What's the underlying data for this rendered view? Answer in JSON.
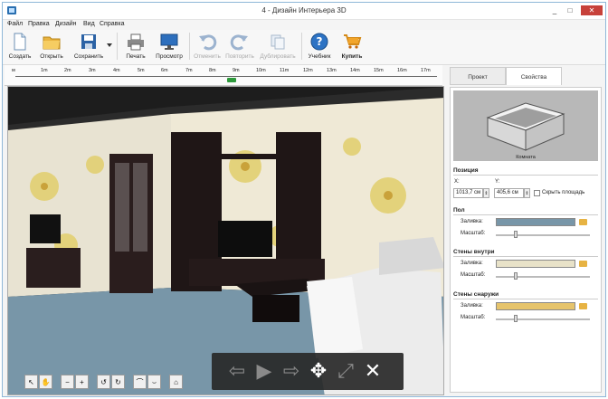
{
  "window": {
    "title": "4 - Дизайн Интерьера 3D",
    "minimize": "_",
    "maximize": "□",
    "close": "✕"
  },
  "menu": [
    "Файл",
    "Правка",
    "Дизайн",
    "Вид",
    "Справка"
  ],
  "toolbar": {
    "create": "Создать",
    "open": "Открыть",
    "save": "Сохранить",
    "print": "Печать",
    "preview": "Просмотр",
    "undo": "Отменить",
    "redo": "Повторить",
    "duplicate": "Дублировать",
    "tutorial": "Учебник",
    "buy": "Купить"
  },
  "ruler": {
    "ticks": [
      "м",
      "1m",
      "2m",
      "3m",
      "4m",
      "5m",
      "6m",
      "7m",
      "8m",
      "9m",
      "10m",
      "11m",
      "12m",
      "13m",
      "14m",
      "15m",
      "16m",
      "17m"
    ]
  },
  "nav": {
    "pointer": "↖",
    "hand": "✋",
    "zoom_out": "−",
    "zoom_in": "+",
    "rotate_left": "↺",
    "rotate_right": "↻",
    "tilt_up": "⌒",
    "tilt_down": "⌣",
    "home": "⌂"
  },
  "overlay": {
    "back": "⇦",
    "play": "▶",
    "forward": "⇨",
    "move": "✥",
    "resize": "⤢",
    "close": "✕"
  },
  "panel": {
    "tabs": [
      "Проект",
      "Свойства"
    ],
    "preview_caption": "Комната",
    "position": {
      "title": "Позиция",
      "x_label": "X:",
      "y_label": "Y:",
      "x_value": "1013,7 см",
      "y_value": "405,6 см",
      "hide_area": "Скрыть площадь"
    },
    "floor": {
      "title": "Пол",
      "fill": "Заливка:",
      "scale": "Масштаб:"
    },
    "walls_in": {
      "title": "Стены внутри",
      "fill": "Заливка:",
      "scale": "Масштаб:"
    },
    "walls_out": {
      "title": "Стены снаружи",
      "fill": "Заливка:",
      "scale": "Масштаб:"
    }
  },
  "colors": {
    "floor": "#7896a8",
    "walls_in": "#e8e2c8",
    "walls_out": "#e6c46c",
    "accent": "#2a6fb0"
  }
}
